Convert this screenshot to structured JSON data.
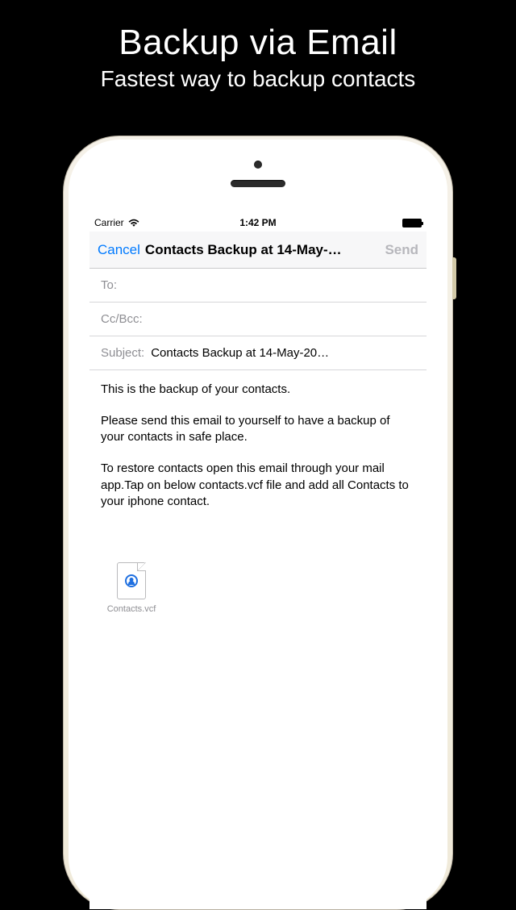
{
  "promo": {
    "title": "Backup via Email",
    "subtitle": "Fastest way to backup contacts"
  },
  "statusbar": {
    "carrier": "Carrier",
    "time": "1:42 PM"
  },
  "navbar": {
    "cancel": "Cancel",
    "title": "Contacts Backup at 14-May-…",
    "send": "Send"
  },
  "fields": {
    "to_label": "To:",
    "to_value": "",
    "ccbcc_label": "Cc/Bcc:",
    "ccbcc_value": "",
    "subject_label": "Subject:",
    "subject_value": "Contacts Backup at 14-May-20…"
  },
  "body": {
    "p1": "This is the backup of your contacts.",
    "p2": "Please send this email to yourself to have a backup of your contacts in safe place.",
    "p3": "To restore contacts open this email through your mail app.Tap on below contacts.vcf file and add all Contacts to your iphone contact."
  },
  "attachment": {
    "filename": "Contacts.vcf"
  }
}
